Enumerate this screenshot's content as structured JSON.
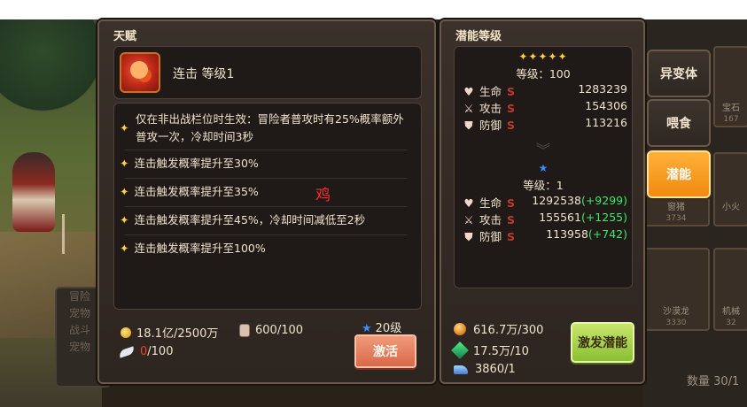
{
  "talent": {
    "title": "天赋",
    "skill_name": "连击 等级1",
    "effects": [
      "仅在非出战栏位时生效：冒险者普攻时有25%概率额外普攻一次，冷却时间3秒",
      "连击触发概率提升至30%",
      "连击触发概率提升至35%",
      "连击触发概率提升至45%，冷却时间减低至2秒",
      "连击触发概率提升至100%"
    ],
    "watermark": "鸡",
    "resources": {
      "gold": "18.1亿/2500万",
      "jar": "600/100",
      "feather_current": "0",
      "feather_required": "/100"
    },
    "level_requirement": "20级",
    "activate_label": "激活"
  },
  "potential": {
    "title": "潜能等级",
    "current": {
      "stars": "✦✦✦✦✦",
      "level": "等级：100",
      "stats": [
        {
          "icon": "heart-icon",
          "glyph": "♥",
          "label": "生命",
          "grade": "S",
          "value": "1283239",
          "delta": ""
        },
        {
          "icon": "sword-icon",
          "glyph": "⚔",
          "label": "攻击",
          "grade": "S",
          "value": "154306",
          "delta": ""
        },
        {
          "icon": "shield-icon",
          "glyph": "⛊",
          "label": "防御",
          "grade": "S",
          "value": "113216",
          "delta": ""
        }
      ]
    },
    "next": {
      "level": "等级：1",
      "stats": [
        {
          "icon": "heart-icon",
          "glyph": "♥",
          "label": "生命",
          "grade": "S",
          "value": "1292538",
          "delta": "(+9299)"
        },
        {
          "icon": "sword-icon",
          "glyph": "⚔",
          "label": "攻击",
          "grade": "S",
          "value": "155561",
          "delta": "(+1255)"
        },
        {
          "icon": "shield-icon",
          "glyph": "⛊",
          "label": "防御",
          "grade": "S",
          "value": "113958",
          "delta": "(+742)"
        }
      ]
    },
    "resources": [
      "616.7万/300",
      "17.5万/10",
      "3860/1"
    ],
    "awaken_label": "激发潜能"
  },
  "side_tabs": [
    {
      "label": "异变体",
      "active": false
    },
    {
      "label": "喂食",
      "active": false
    },
    {
      "label": "潜能",
      "active": true
    }
  ],
  "background": {
    "left_menu": [
      "冒险",
      "宠物",
      "战斗",
      "宠物"
    ],
    "cards": [
      {
        "label": "宝石",
        "num": "167"
      },
      {
        "label": "窗猪",
        "num": "3734"
      },
      {
        "label": "小火",
        "num": ""
      },
      {
        "label": "沙漠龙",
        "num": "3330"
      },
      {
        "label": "机械",
        "num": "32"
      }
    ],
    "count": "数量 30/1"
  },
  "colors": {
    "accent_orange": "#f08a10",
    "activate_button": "#d8694a",
    "awaken_button": "#8abf34",
    "grade_s": "#c0392b",
    "delta_green": "#3ee86a"
  }
}
